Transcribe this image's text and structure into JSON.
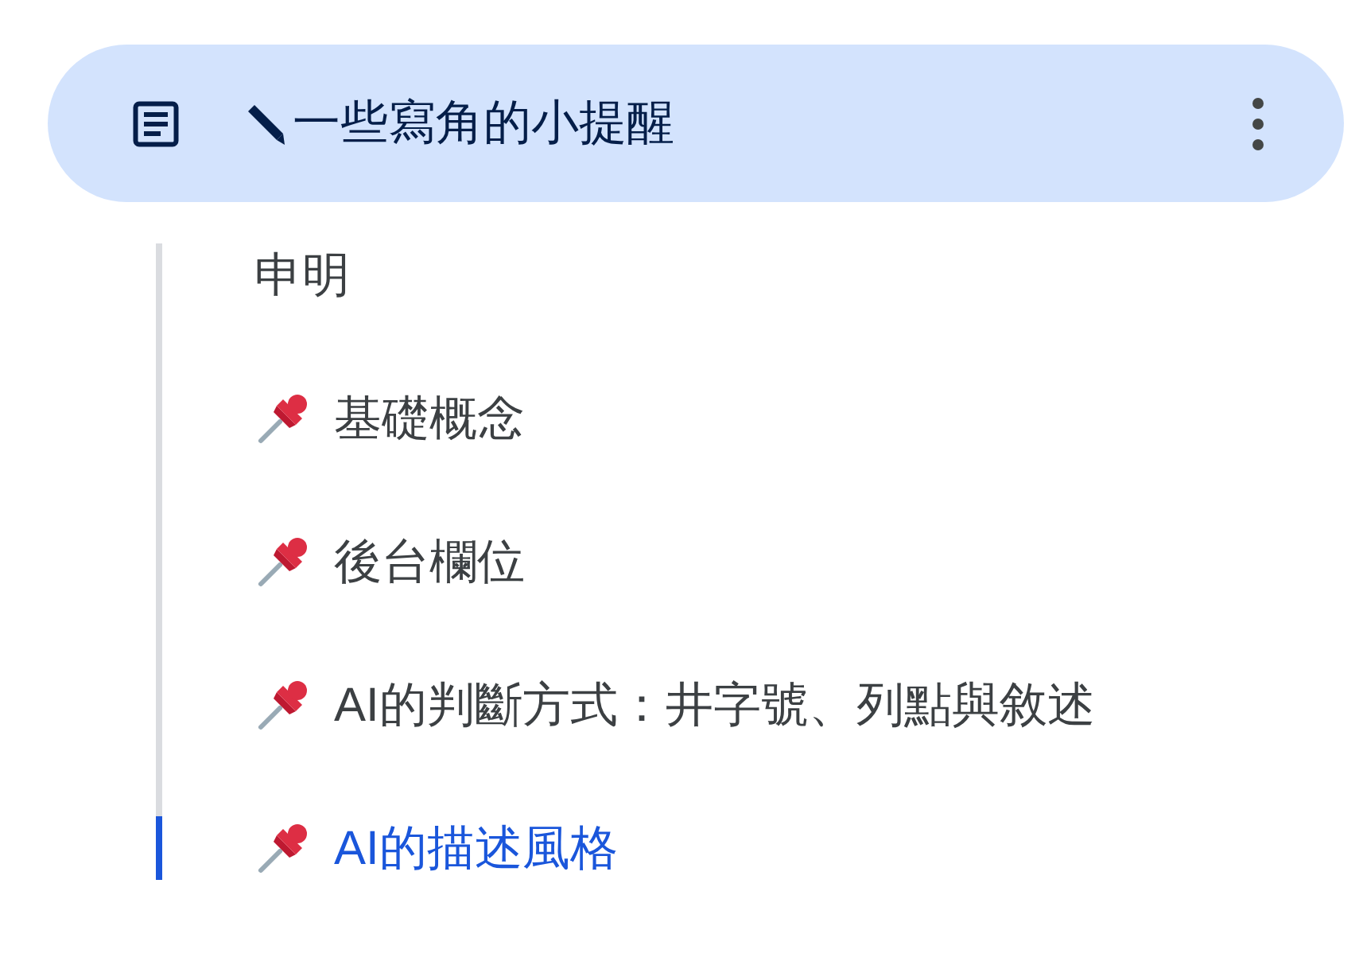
{
  "outline": {
    "title": "一些寫角的小提醒",
    "items": [
      {
        "label": "申明",
        "kind": "plain",
        "selected": false
      },
      {
        "label": "基礎概念",
        "kind": "pinned",
        "selected": false
      },
      {
        "label": "後台欄位",
        "kind": "pinned",
        "selected": false
      },
      {
        "label": "AI的判斷方式：井字號、列點與敘述",
        "kind": "pinned",
        "selected": false
      },
      {
        "label": "AI的描述風格",
        "kind": "pinned",
        "selected": true
      }
    ]
  }
}
